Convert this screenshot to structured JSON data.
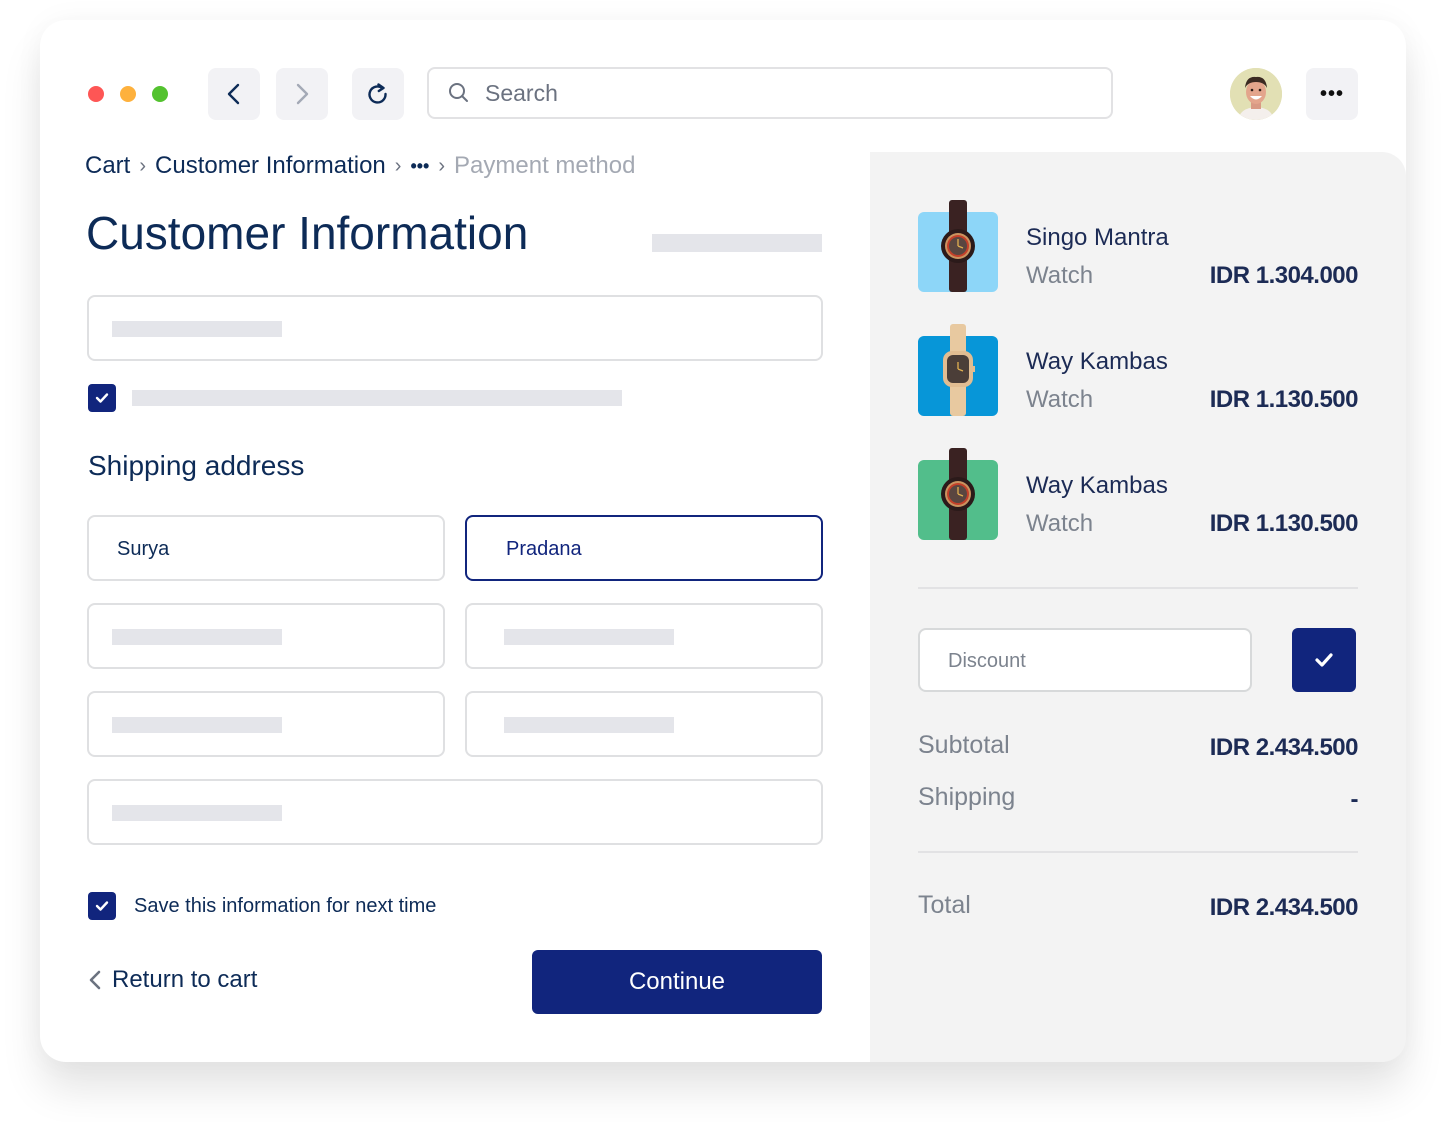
{
  "browser": {
    "traffic_lights": [
      "#fe5655",
      "#feb13d",
      "#53c22f"
    ],
    "back_icon": "chevron-left-icon",
    "forward_icon": "chevron-right-icon",
    "reload_icon": "reload-icon",
    "search": {
      "placeholder": "Search",
      "value": ""
    },
    "more_label": "•••"
  },
  "breadcrumb": {
    "items": [
      "Cart",
      "Customer Information",
      "•••",
      "Payment method"
    ],
    "separator": "›"
  },
  "form": {
    "title": "Customer Information",
    "shipping_title": "Shipping address",
    "first_name": "Surya",
    "last_name": "Pradana",
    "save_label": "Save this information for next time",
    "save_checked": true,
    "newsletter_checked": true,
    "return_label": "Return to cart",
    "continue_label": "Continue"
  },
  "cart": {
    "items": [
      {
        "name": "Singo Mantra",
        "category": "Watch",
        "price": "IDR 1.304.000",
        "thumb_color": "#8dd6f8"
      },
      {
        "name": "Way Kambas",
        "category": "Watch",
        "price": "IDR 1.130.500",
        "thumb_color": "#0796d8"
      },
      {
        "name": "Way Kambas",
        "category": "Watch",
        "price": "IDR 1.130.500",
        "thumb_color": "#52be8b"
      }
    ],
    "discount_placeholder": "Discount",
    "subtotal_label": "Subtotal",
    "subtotal_value": "IDR 2.434.500",
    "shipping_label": "Shipping",
    "shipping_value": "-",
    "total_label": "Total",
    "total_value": "IDR 2.434.500"
  },
  "colors": {
    "primary": "#11257d",
    "text_dark": "#0d2b57",
    "muted": "#7c838e",
    "panel_bg": "#f3f3f3"
  }
}
